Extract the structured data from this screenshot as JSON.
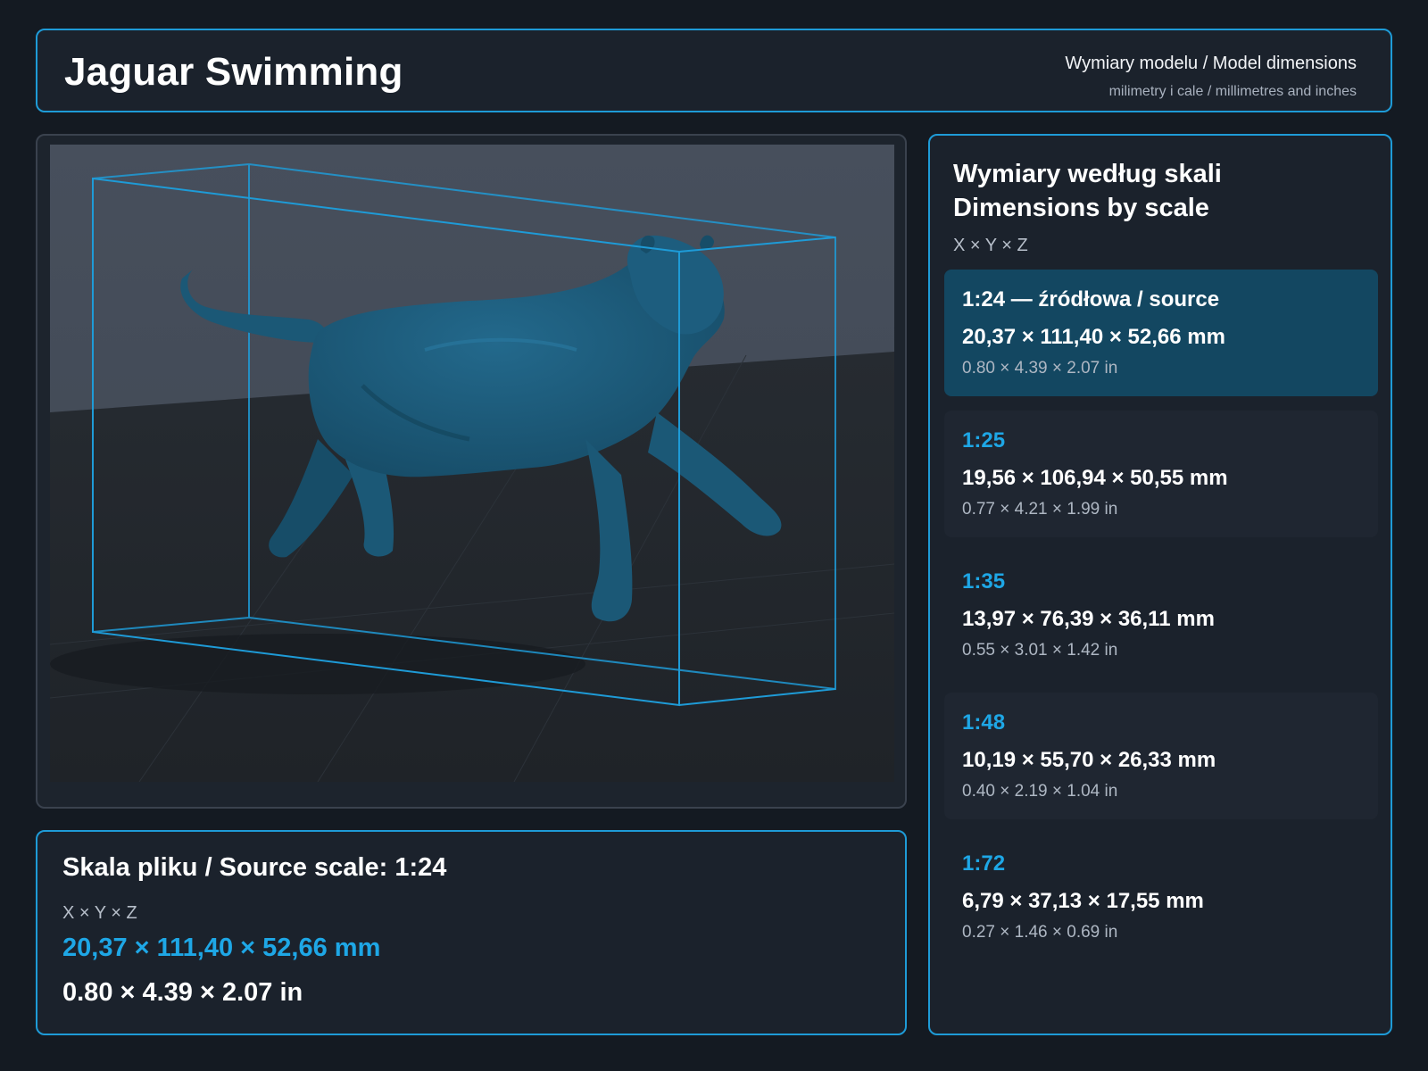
{
  "header": {
    "title": "Jaguar Swimming",
    "subtitle": "Wymiary modelu / Model dimensions",
    "units_note": "milimetry i cale / millimetres and inches"
  },
  "viewer": {
    "model_color": "#1b5876",
    "box_color": "#1e9bd7",
    "icon": "jaguar-model-render"
  },
  "source": {
    "label": "Skala pliku / Source scale: 1:24",
    "axes": "X × Y × Z",
    "mm": "20,37 × 111,40 × 52,66 mm",
    "inch": "0.80 × 4.39 × 2.07 in"
  },
  "scales": {
    "heading_line1": "Wymiary według skali",
    "heading_line2": "Dimensions by scale",
    "axes": "X × Y × Z",
    "items": [
      {
        "name": "1:24  —  źródłowa / source",
        "mm": "20,37 × 111,40 × 52,66 mm",
        "inch": "0.80 × 4.39 × 2.07 in"
      },
      {
        "name": "1:25",
        "mm": "19,56 × 106,94 × 50,55 mm",
        "inch": "0.77 × 4.21 × 1.99 in"
      },
      {
        "name": "1:35",
        "mm": "13,97 × 76,39 × 36,11 mm",
        "inch": "0.55 × 3.01 × 1.42 in"
      },
      {
        "name": "1:48",
        "mm": "10,19 × 55,70 × 26,33 mm",
        "inch": "0.40 × 2.19 × 1.04 in"
      },
      {
        "name": "1:72",
        "mm": "6,79 × 37,13 × 17,55 mm",
        "inch": "0.27 × 1.46 × 0.69 in"
      }
    ]
  },
  "colors": {
    "accent": "#1e9bd7",
    "highlight_card": "#134761",
    "background": "#141a22"
  }
}
